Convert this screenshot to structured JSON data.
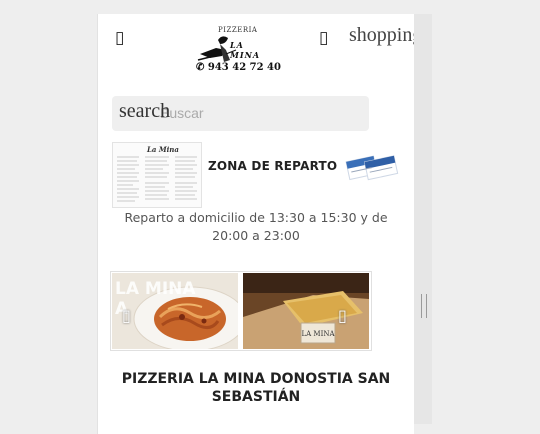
{
  "header": {
    "menu_glyph": "▯",
    "cart_glyph": "▯",
    "shopping_text": "shopping"
  },
  "logo": {
    "top": "PIZZERIA",
    "name": "LA MINA",
    "phone": "943 42 72 40"
  },
  "search": {
    "label": "search",
    "placeholder": "Buscar"
  },
  "delivery": {
    "menu_image_title": "La Mina",
    "title": "ZONA DE REPARTO",
    "text": "Reparto a domicilio de 13:30 a 15:30 y de 20:00 a 23:00"
  },
  "gallery": {
    "overlay_line1": "LA MINA",
    "overlay_line2": "A",
    "prev_glyph": "▯",
    "next_glyph": "▯"
  },
  "main": {
    "title": "PIZZERIA LA MINA DONOSTIA SAN SEBASTIÁN"
  },
  "colors": {
    "background": "#eeeeee",
    "panel": "#ffffff",
    "text": "#222222",
    "muted": "#555555"
  }
}
